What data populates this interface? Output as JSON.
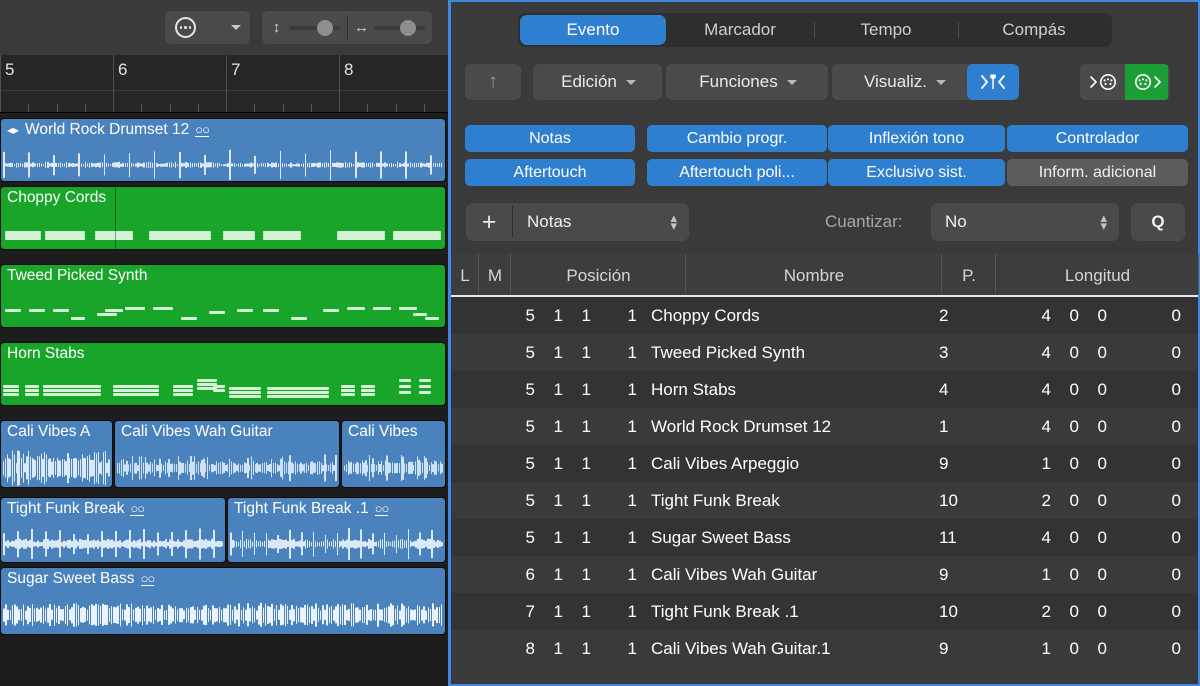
{
  "arrange": {
    "toolbar": {
      "catch_menu_icon": "ellipsis-circle-icon",
      "chevron_icon": "chevron-down-icon",
      "vertical_zoom_icon": "↕",
      "horizontal_zoom_icon": "↔"
    },
    "ruler": {
      "bars": [
        "5",
        "6",
        "7",
        "8"
      ]
    },
    "regions": [
      {
        "name": "World Rock Drumset 12",
        "color": "blue",
        "loop": true,
        "updown": true,
        "type": "audio"
      },
      {
        "name": "Choppy Cords",
        "color": "green",
        "loop": false,
        "type": "midi"
      },
      {
        "name": "Tweed Picked Synth",
        "color": "green",
        "loop": false,
        "type": "midi"
      },
      {
        "name": "Horn Stabs",
        "color": "green",
        "loop": false,
        "type": "midi"
      },
      {
        "name": "Cali Vibes A",
        "color": "blue",
        "loop": false,
        "type": "audio"
      },
      {
        "name": "Cali Vibes Wah Guitar",
        "color": "blue",
        "loop": false,
        "type": "audio"
      },
      {
        "name": "Cali Vibes",
        "color": "blue",
        "loop": false,
        "type": "audio"
      },
      {
        "name": "Tight Funk Break",
        "color": "blue",
        "loop": true,
        "type": "audio"
      },
      {
        "name": "Tight Funk Break .1",
        "color": "blue",
        "loop": true,
        "type": "audio"
      },
      {
        "name": "Sugar Sweet Bass",
        "color": "blue",
        "loop": true,
        "type": "audio"
      }
    ]
  },
  "event_list": {
    "tabs": [
      {
        "label": "Evento",
        "active": true
      },
      {
        "label": "Marcador",
        "active": false
      },
      {
        "label": "Tempo",
        "active": false
      },
      {
        "label": "Compás",
        "active": false
      }
    ],
    "toolbar": {
      "up_icon": "arrow-up-icon",
      "menus": [
        "Edición",
        "Funciones",
        "Visualiz."
      ],
      "split_button_icon": "note-split-icon",
      "midi_in_icon": "midi-in-icon",
      "midi_out_icon": "midi-out-icon"
    },
    "filters": [
      {
        "label": "Notas",
        "active": true
      },
      {
        "label": "Cambio progr.",
        "active": true
      },
      {
        "label": "Inflexión tono",
        "active": true
      },
      {
        "label": "Controlador",
        "active": true
      },
      {
        "label": "Aftertouch",
        "active": true
      },
      {
        "label": "Aftertouch poli...",
        "active": true
      },
      {
        "label": "Exclusivo sist.",
        "active": true
      },
      {
        "label": "Inform. adicional",
        "active": false
      }
    ],
    "add_row": {
      "plus_label": "+",
      "event_type": "Notas",
      "quantize_label": "Cuantizar:",
      "quantize_value": "No",
      "q_button": "Q"
    },
    "columns": [
      "L",
      "M",
      "Posición",
      "Nombre",
      "P.",
      "Longitud"
    ],
    "rows": [
      {
        "pos": [
          "5",
          "1",
          "1"
        ],
        "sub": "1",
        "name": "Choppy Cords",
        "p": "2",
        "len": [
          "4",
          "0",
          "0"
        ],
        "len_sub": "0"
      },
      {
        "pos": [
          "5",
          "1",
          "1"
        ],
        "sub": "1",
        "name": "Tweed Picked Synth",
        "p": "3",
        "len": [
          "4",
          "0",
          "0"
        ],
        "len_sub": "0"
      },
      {
        "pos": [
          "5",
          "1",
          "1"
        ],
        "sub": "1",
        "name": "Horn Stabs",
        "p": "4",
        "len": [
          "4",
          "0",
          "0"
        ],
        "len_sub": "0"
      },
      {
        "pos": [
          "5",
          "1",
          "1"
        ],
        "sub": "1",
        "name": "World Rock Drumset 12",
        "p": "1",
        "len": [
          "4",
          "0",
          "0"
        ],
        "len_sub": "0"
      },
      {
        "pos": [
          "5",
          "1",
          "1"
        ],
        "sub": "1",
        "name": "Cali Vibes Arpeggio",
        "p": "9",
        "len": [
          "1",
          "0",
          "0"
        ],
        "len_sub": "0"
      },
      {
        "pos": [
          "5",
          "1",
          "1"
        ],
        "sub": "1",
        "name": "Tight Funk Break",
        "p": "10",
        "len": [
          "2",
          "0",
          "0"
        ],
        "len_sub": "0"
      },
      {
        "pos": [
          "5",
          "1",
          "1"
        ],
        "sub": "1",
        "name": "Sugar Sweet Bass",
        "p": "11",
        "len": [
          "4",
          "0",
          "0"
        ],
        "len_sub": "0"
      },
      {
        "pos": [
          "6",
          "1",
          "1"
        ],
        "sub": "1",
        "name": "Cali Vibes Wah Guitar",
        "p": "9",
        "len": [
          "1",
          "0",
          "0"
        ],
        "len_sub": "0"
      },
      {
        "pos": [
          "7",
          "1",
          "1"
        ],
        "sub": "1",
        "name": "Tight Funk Break .1",
        "p": "10",
        "len": [
          "2",
          "0",
          "0"
        ],
        "len_sub": "0"
      },
      {
        "pos": [
          "8",
          "1",
          "1"
        ],
        "sub": "1",
        "name": "Cali Vibes Wah Guitar.1",
        "p": "9",
        "len": [
          "1",
          "0",
          "0"
        ],
        "len_sub": "0"
      }
    ]
  },
  "colors": {
    "accent_blue": "#2f7fd1",
    "focus_border": "#3f87e0",
    "midi_green": "#19a52a",
    "audio_blue": "#4a82bd",
    "midi_out_green": "#1a9e35"
  }
}
